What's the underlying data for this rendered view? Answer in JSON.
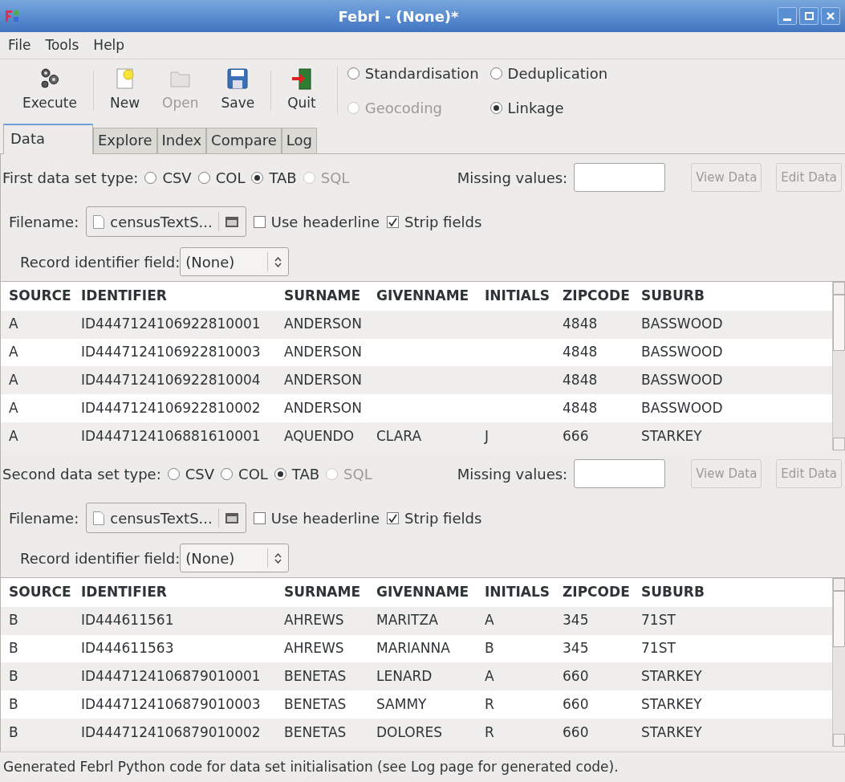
{
  "window": {
    "title": "Febrl - (None)*"
  },
  "menu": [
    "File",
    "Tools",
    "Help"
  ],
  "toolbar": [
    {
      "kind": "execute",
      "label": "Execute",
      "disabled": false
    },
    {
      "kind": "new",
      "label": "New",
      "disabled": false
    },
    {
      "kind": "open",
      "label": "Open",
      "disabled": true
    },
    {
      "kind": "save",
      "label": "Save",
      "disabled": false
    },
    {
      "kind": "quit",
      "label": "Quit",
      "disabled": false
    }
  ],
  "modes": [
    {
      "label": "Standardisation",
      "selected": false,
      "disabled": false
    },
    {
      "label": "Deduplication",
      "selected": false,
      "disabled": false
    },
    {
      "label": "Geocoding",
      "selected": false,
      "disabled": true
    },
    {
      "label": "Linkage",
      "selected": true,
      "disabled": false
    }
  ],
  "tabs": [
    {
      "label": "Data",
      "selected": true
    },
    {
      "label": "Explore",
      "selected": false
    },
    {
      "label": "Index",
      "selected": false
    },
    {
      "label": "Compare",
      "selected": false
    },
    {
      "label": "Log",
      "selected": false
    }
  ],
  "data_sets": [
    {
      "type_label": "First data set type:",
      "types": [
        {
          "label": "CSV",
          "selected": false,
          "disabled": false
        },
        {
          "label": "COL",
          "selected": false,
          "disabled": false
        },
        {
          "label": "TAB",
          "selected": true,
          "disabled": false
        },
        {
          "label": "SQL",
          "selected": false,
          "disabled": true
        }
      ],
      "missing_values_label": "Missing values:",
      "buttons": [
        {
          "label": "View Data",
          "disabled": true
        },
        {
          "label": "Edit Data",
          "disabled": true
        }
      ],
      "filename_label": "Filename:",
      "filename": "censusTextS...",
      "use_headerline": {
        "label": "Use headerline",
        "checked": false
      },
      "strip_fields": {
        "label": "Strip fields",
        "checked": true
      },
      "record_id_label": "Record identifier field:",
      "record_id_value": "(None)",
      "table": {
        "columns": [
          "SOURCE",
          "IDENTIFIER",
          "SURNAME",
          "GIVENNAME",
          "INITIALS",
          "ZIPCODE",
          "SUBURB"
        ],
        "rows": [
          [
            "A",
            "ID4447124106922810001",
            "ANDERSON",
            "",
            "",
            "4848",
            "BASSWOOD"
          ],
          [
            "A",
            "ID4447124106922810003",
            "ANDERSON",
            "",
            "",
            "4848",
            "BASSWOOD"
          ],
          [
            "A",
            "ID4447124106922810004",
            "ANDERSON",
            "",
            "",
            "4848",
            "BASSWOOD"
          ],
          [
            "A",
            "ID4447124106922810002",
            "ANDERSON",
            "",
            "",
            "4848",
            "BASSWOOD"
          ],
          [
            "A",
            "ID4447124106881610001",
            "AQUENDO",
            "CLARA",
            "J",
            "666",
            "STARKEY"
          ]
        ]
      }
    },
    {
      "type_label": "Second data set type:",
      "types": [
        {
          "label": "CSV",
          "selected": false,
          "disabled": false
        },
        {
          "label": "COL",
          "selected": false,
          "disabled": false
        },
        {
          "label": "TAB",
          "selected": true,
          "disabled": false
        },
        {
          "label": "SQL",
          "selected": false,
          "disabled": true
        }
      ],
      "missing_values_label": "Missing values:",
      "buttons": [
        {
          "label": "View Data",
          "disabled": true
        },
        {
          "label": "Edit Data",
          "disabled": true
        }
      ],
      "filename_label": "Filename:",
      "filename": "censusTextS...",
      "use_headerline": {
        "label": "Use headerline",
        "checked": false
      },
      "strip_fields": {
        "label": "Strip fields",
        "checked": true
      },
      "record_id_label": "Record identifier field:",
      "record_id_value": "(None)",
      "table": {
        "columns": [
          "SOURCE",
          "IDENTIFIER",
          "SURNAME",
          "GIVENNAME",
          "INITIALS",
          "ZIPCODE",
          "SUBURB"
        ],
        "rows": [
          [
            "B",
            "ID444611561",
            "AHREWS",
            "MARITZA",
            "A",
            "345",
            "71ST"
          ],
          [
            "B",
            "ID444611563",
            "AHREWS",
            "MARIANNA",
            "B",
            "345",
            "71ST"
          ],
          [
            "B",
            "ID4447124106879010001",
            "BENETAS",
            "LENARD",
            "A",
            "660",
            "STARKEY"
          ],
          [
            "B",
            "ID4447124106879010003",
            "BENETAS",
            "SAMMY",
            "R",
            "660",
            "STARKEY"
          ],
          [
            "B",
            "ID4447124106879010002",
            "BENETAS",
            "DOLORES",
            "R",
            "660",
            "STARKEY"
          ]
        ]
      }
    }
  ],
  "status_bar": "Generated Febrl Python code for data set initialisation (see Log page for generated code)."
}
